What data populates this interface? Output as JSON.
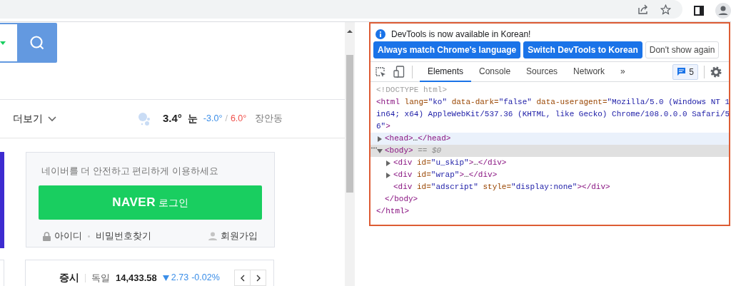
{
  "nav": {
    "more_label": "더보기"
  },
  "weather": {
    "temperature": "3.4°",
    "condition": "눈",
    "low": "-3.0°",
    "separator": "/",
    "high": "6.0°",
    "location": "장안동"
  },
  "login": {
    "message": "네이버를 더 안전하고 편리하게 이용하세요",
    "button": "**NAVER** 로그인",
    "links": [
      {
        "kind": "id",
        "text": "아이디"
      },
      {
        "kind": "password",
        "text": "비밀번호찾기"
      },
      {
        "kind": "signup",
        "text": "회원가입"
      }
    ]
  },
  "stock": {
    "label": "증시",
    "market": "독일",
    "value": "14,433.58",
    "falling": true,
    "change": "2.73",
    "change_pct": "-0.02%"
  },
  "devtools": {
    "notice": "DevTools is now available in Korean!",
    "notice_buttons": [
      {
        "label": "Always match Chrome's language",
        "kind": "primary"
      },
      {
        "label": "Switch DevTools to Korean",
        "kind": "primary"
      },
      {
        "label": "Don't show again",
        "kind": "secondary"
      }
    ],
    "tabs": [
      {
        "label": "Elements",
        "selected": true
      },
      {
        "label": "Console",
        "selected": false
      },
      {
        "label": "Sources",
        "selected": false
      },
      {
        "label": "Network",
        "selected": false
      }
    ],
    "more_tabs": "»",
    "issues_count": "5",
    "dom": {
      "doctype": "<!DOCTYPE html>",
      "root": {
        "expandable": false,
        "expanded": true,
        "selected": false,
        "hovered": false,
        "lines": [
          [
            {
              "kind": "tag",
              "text": "<html"
            },
            {
              "kind": "attr",
              "text": " lang="
            },
            {
              "kind": "value",
              "text": "\"ko\""
            },
            {
              "kind": "attr",
              "text": " data-dark="
            },
            {
              "kind": "value",
              "text": "\"false\""
            },
            {
              "kind": "attr",
              "text": " data-useragent="
            },
            {
              "kind": "value",
              "text": "\"Mozilla/5.0 (Windows NT 1"
            }
          ],
          [
            {
              "kind": "value",
              "text": "in64; x64) AppleWebKit/537.36 (KHTML, like Gecko) Chrome/108.0.0.0 Safari/5"
            }
          ],
          [
            {
              "kind": "value",
              "text": "6\""
            },
            {
              "kind": "tag",
              "text": ">"
            }
          ]
        ],
        "children": [
          {
            "expandable": true,
            "expanded": false,
            "selected": false,
            "hovered": true,
            "lines": [
              [
                {
                  "kind": "tag",
                  "text": "<head>"
                },
                {
                  "kind": "ellipsis",
                  "text": "…"
                },
                {
                  "kind": "tag",
                  "text": "</head>"
                }
              ]
            ]
          },
          {
            "expandable": true,
            "expanded": true,
            "selected": true,
            "hovered": false,
            "lines": [
              [
                {
                  "kind": "tag",
                  "text": "<body>"
                },
                {
                  "kind": "marker",
                  "text": " == $0"
                }
              ]
            ],
            "children": [
              {
                "expandable": true,
                "expanded": false,
                "selected": false,
                "hovered": false,
                "lines": [
                  [
                    {
                      "kind": "tag",
                      "text": "<div"
                    },
                    {
                      "kind": "attr",
                      "text": " id="
                    },
                    {
                      "kind": "value",
                      "text": "\"u_skip\""
                    },
                    {
                      "kind": "tag",
                      "text": ">"
                    },
                    {
                      "kind": "ellipsis",
                      "text": "…"
                    },
                    {
                      "kind": "tag",
                      "text": "</div>"
                    }
                  ]
                ]
              },
              {
                "expandable": true,
                "expanded": false,
                "selected": false,
                "hovered": false,
                "lines": [
                  [
                    {
                      "kind": "tag",
                      "text": "<div"
                    },
                    {
                      "kind": "attr",
                      "text": " id="
                    },
                    {
                      "kind": "value",
                      "text": "\"wrap\""
                    },
                    {
                      "kind": "tag",
                      "text": ">"
                    },
                    {
                      "kind": "ellipsis",
                      "text": "…"
                    },
                    {
                      "kind": "tag",
                      "text": "</div>"
                    }
                  ]
                ]
              },
              {
                "expandable": false,
                "expanded": false,
                "selected": false,
                "hovered": false,
                "lines": [
                  [
                    {
                      "kind": "tag",
                      "text": "<div"
                    },
                    {
                      "kind": "attr",
                      "text": " id="
                    },
                    {
                      "kind": "value",
                      "text": "\"adscript\""
                    },
                    {
                      "kind": "attr",
                      "text": " style="
                    },
                    {
                      "kind": "value",
                      "text": "\"display:none\""
                    },
                    {
                      "kind": "tag",
                      "text": "></div>"
                    }
                  ]
                ]
              }
            ],
            "close": [
              {
                "kind": "tag",
                "text": "</body>"
              }
            ]
          }
        ],
        "close": [
          {
            "kind": "tag",
            "text": "</html>"
          }
        ]
      }
    }
  }
}
